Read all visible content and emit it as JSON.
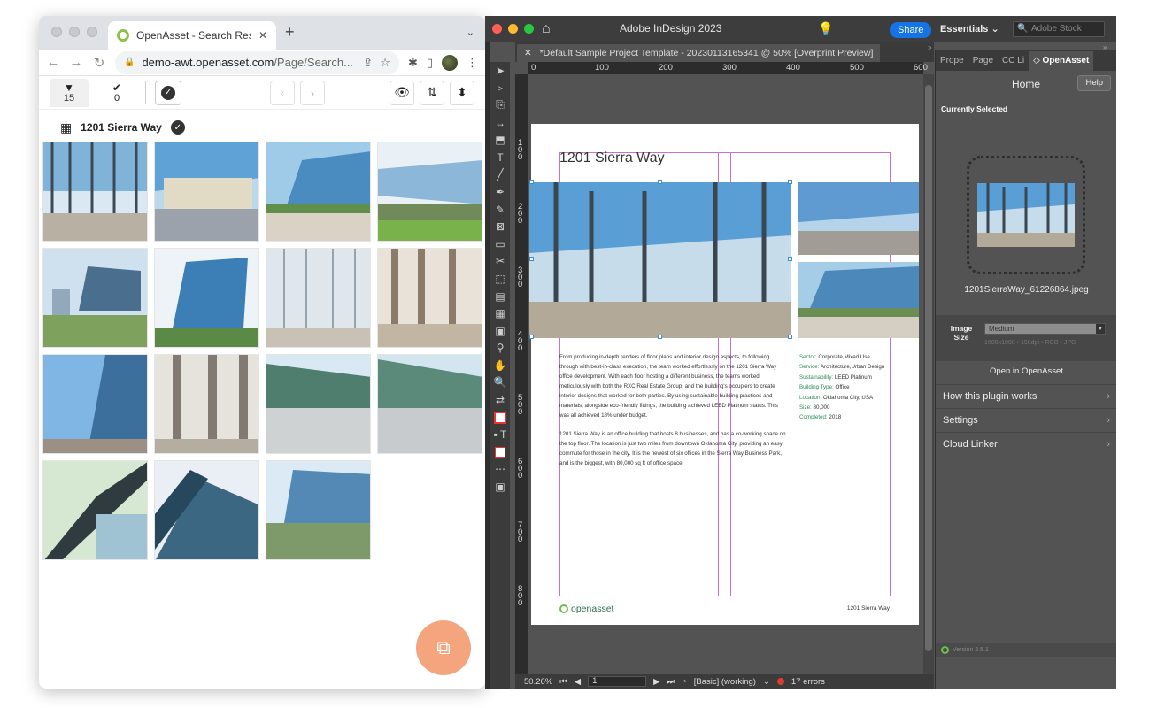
{
  "browser": {
    "tab_title": "OpenAsset - Search Results",
    "new_tab": "+",
    "tab_menu": "⌄",
    "url_host": "demo-awt.openasset.com",
    "url_rest": "/Page/Search...",
    "toolbar": {
      "filter_count": "15",
      "selected_count": "0"
    },
    "heading": "1201 Sierra Way"
  },
  "indesign": {
    "app_title": "Adobe InDesign 2023",
    "share_label": "Share",
    "workspace": "Essentials",
    "stock_placeholder": "Adobe Stock",
    "doc_tab": "*Default Sample Project Template - 20230113165341 @ 50% [Overprint Preview]",
    "ruler_top": [
      "0",
      "100",
      "200",
      "300",
      "400",
      "500",
      "600"
    ],
    "ruler_left": [
      "1\n0\n0",
      "2\n0\n0",
      "3\n0\n0",
      "4\n0\n0",
      "5\n0\n0",
      "6\n0\n0",
      "7\n0\n0",
      "8\n0\n0"
    ],
    "page": {
      "title": "1201 Sierra Way",
      "para1": "From producing in-depth renders of floor plans and interior design aspects, to following through with best-in-class execution, the team worked effortlessly on the 1201 Sierra Way office development. With each floor hosting a different business, the teams worked meticulously with both the RXC Real Estate Group, and the building's occupiers to create interior designs that worked for both parties. By using sustainable building practices and materials, alongside eco-friendly fittings, the building achieved LEED Platinum status. This was all achieved 18% under budget.",
      "para2": "1201 Sierra Way is an office building that hosts 8 businesses, and has a co-working space on the top floor. The location is just two miles from downtown Oklahoma City, providing an easy commute for those in the city. It is the newest of six offices in the Sierra Way Business Park, and is the biggest, with 80,000 sq ft of office space.",
      "meta": [
        {
          "k": "Sector:",
          "v": "Corporate,Mixed Use"
        },
        {
          "k": "Service:",
          "v": "Architecture,Urban Design"
        },
        {
          "k": "Sustainability:",
          "v": "LEED Platinum"
        },
        {
          "k": "Building Type:",
          "v": "Office"
        },
        {
          "k": "Location:",
          "v": "Oklahoma City, USA"
        },
        {
          "k": "Size:",
          "v": "80,000"
        },
        {
          "k": "Completed:",
          "v": "2018"
        }
      ],
      "logo": "openasset",
      "footer": "1201 Sierra Way"
    },
    "status": {
      "zoom": "50.26%",
      "page": "1",
      "preflight": "[Basic] (working)",
      "errors": "17 errors"
    },
    "panel": {
      "tabs": [
        "Prope",
        "Page",
        "CC Li",
        "◇ OpenAsset"
      ],
      "home": "Home",
      "help": "Help",
      "currently_selected": "Currently Selected",
      "filename": "1201SierraWay_61226864.jpeg",
      "image_size_label": "Image Size",
      "image_size_value": "Medium",
      "image_size_hint": "1500x1000 • 150dpi • RGB • JPG",
      "open_label": "Open in OpenAsset",
      "links": [
        "How this plugin works",
        "Settings",
        "Cloud Linker"
      ],
      "version": "Version 2.5.1"
    }
  }
}
